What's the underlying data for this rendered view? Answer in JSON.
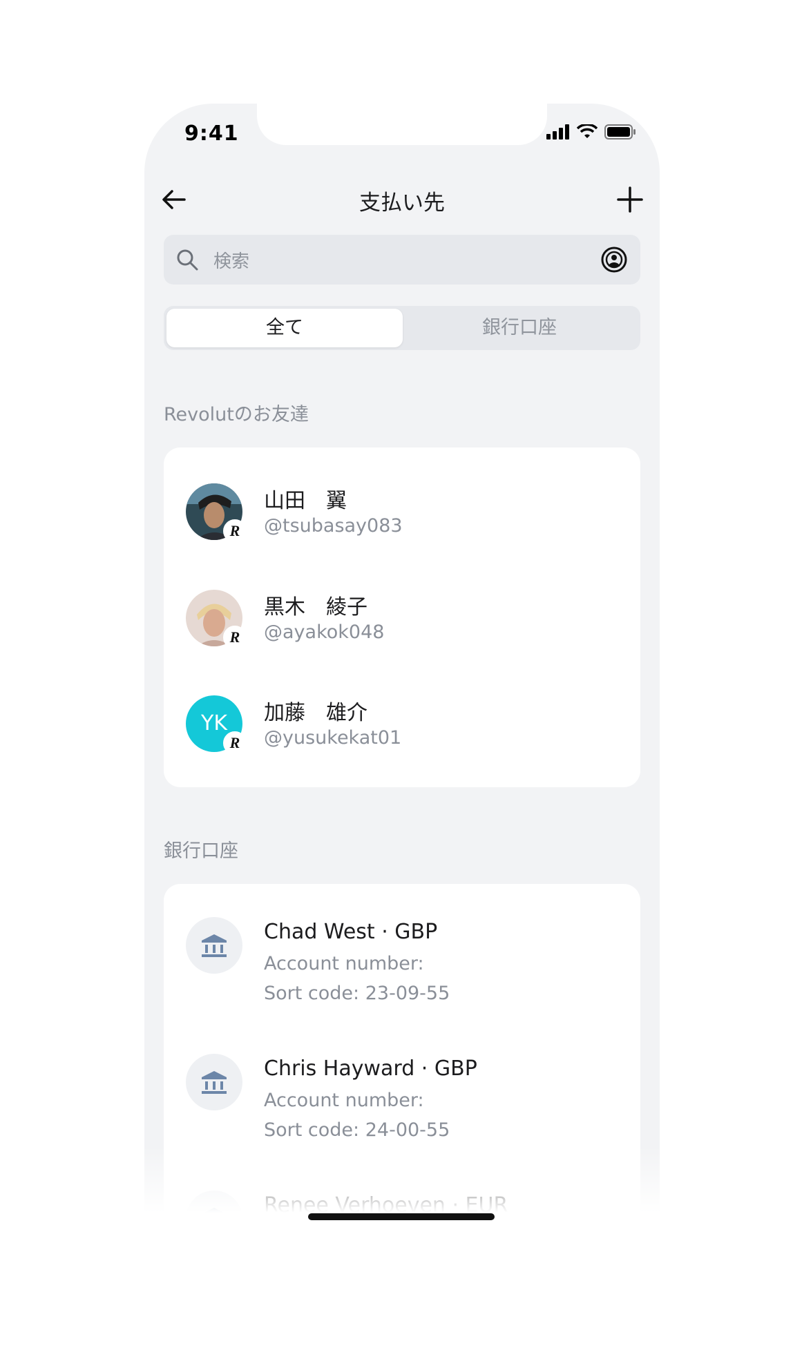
{
  "status_bar": {
    "time": "9:41"
  },
  "header": {
    "title": "支払い先"
  },
  "search": {
    "placeholder": "検索"
  },
  "segments": {
    "all": "全て",
    "bank": "銀行口座"
  },
  "friends": {
    "section_label": "Revolutのお友達",
    "items": [
      {
        "name": "山田　翼",
        "handle": "@tsubasay083",
        "avatar": "photo"
      },
      {
        "name": "黒木　綾子",
        "handle": "@ayakok048",
        "avatar": "photo"
      },
      {
        "name": "加藤　雄介",
        "handle": "@yusukekat01",
        "initials": "YK"
      }
    ],
    "badge": "R"
  },
  "banks": {
    "section_label": "銀行口座",
    "items": [
      {
        "name": "Chad West · GBP",
        "account": "Account number:",
        "sort": "Sort code: 23-09-55"
      },
      {
        "name": "Chris Hayward · GBP",
        "account": "Account number:",
        "sort": "Sort code: 24-00-55"
      },
      {
        "name": "Renee Verhoeven · EUR"
      }
    ]
  },
  "colors": {
    "accent_initials": "#14c8d8",
    "bank_icon": "#6c86a8"
  }
}
